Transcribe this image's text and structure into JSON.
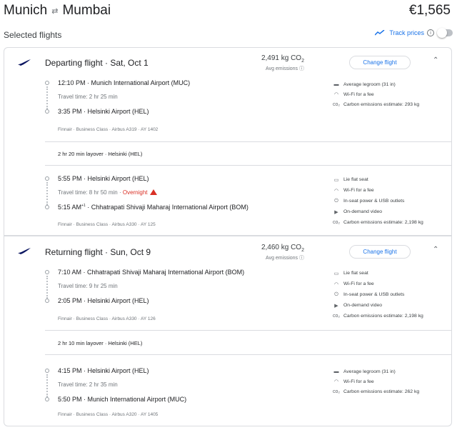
{
  "header": {
    "origin": "Munich",
    "destination": "Mumbai",
    "price": "€1,565"
  },
  "selected_flights_title": "Selected flights",
  "track_prices": {
    "label": "Track prices",
    "enabled": false
  },
  "departing": {
    "title": "Departing flight · Sat, Oct 1",
    "co2": "2,491 kg CO",
    "co2_sub": "2",
    "emissions_label": "Avg emissions",
    "change_label": "Change flight",
    "leg1": {
      "dep_time": "12:10 PM",
      "dep_airport": "Munich International Airport (MUC)",
      "travel": "Travel time: 2 hr 25 min",
      "arr_time": "3:35 PM",
      "arr_airport": "Helsinki Airport (HEL)",
      "meta": "Finnair · Business Class · Airbus A319 · AY 1402",
      "amenities": [
        "Average legroom (31 in)",
        "Wi-Fi for a fee",
        "Carbon emissions estimate: 293 kg"
      ]
    },
    "layover": "2 hr 20 min layover · Helsinki (HEL)",
    "leg2": {
      "dep_time": "5:55 PM",
      "dep_airport": "Helsinki Airport (HEL)",
      "travel": "Travel time: 8 hr 50 min · ",
      "overnight": "Overnight",
      "arr_time": "5:15 AM",
      "arr_sup": "+1",
      "arr_airport": "Chhatrapati Shivaji Maharaj International Airport (BOM)",
      "meta": "Finnair · Business Class · Airbus A330 · AY 125",
      "amenities": [
        "Lie flat seat",
        "Wi-Fi for a fee",
        "In-seat power & USB outlets",
        "On-demand video",
        "Carbon emissions estimate: 2,198 kg"
      ]
    }
  },
  "returning": {
    "title": "Returning flight · Sun, Oct 9",
    "co2": "2,460 kg CO",
    "co2_sub": "2",
    "emissions_label": "Avg emissions",
    "change_label": "Change flight",
    "leg1": {
      "dep_time": "7:10 AM",
      "dep_airport": "Chhatrapati Shivaji Maharaj International Airport (BOM)",
      "travel": "Travel time: 9 hr 25 min",
      "arr_time": "2:05 PM",
      "arr_airport": "Helsinki Airport (HEL)",
      "meta": "Finnair · Business Class · Airbus A330 · AY 126",
      "amenities": [
        "Lie flat seat",
        "Wi-Fi for a fee",
        "In-seat power & USB outlets",
        "On-demand video",
        "Carbon emissions estimate: 2,198 kg"
      ]
    },
    "layover": "2 hr 10 min layover · Helsinki (HEL)",
    "leg2": {
      "dep_time": "4:15 PM",
      "dep_airport": "Helsinki Airport (HEL)",
      "travel": "Travel time: 2 hr 35 min",
      "arr_time": "5:50 PM",
      "arr_airport": "Munich International Airport (MUC)",
      "meta": "Finnair · Business Class · Airbus A320 · AY 1405",
      "amenities": [
        "Average legroom (31 in)",
        "Wi-Fi for a fee",
        "Carbon emissions estimate: 262 kg"
      ]
    }
  },
  "colors": {
    "accent": "#1a73e8",
    "warning": "#d93025",
    "border": "#dadce0",
    "muted": "#70757a"
  }
}
